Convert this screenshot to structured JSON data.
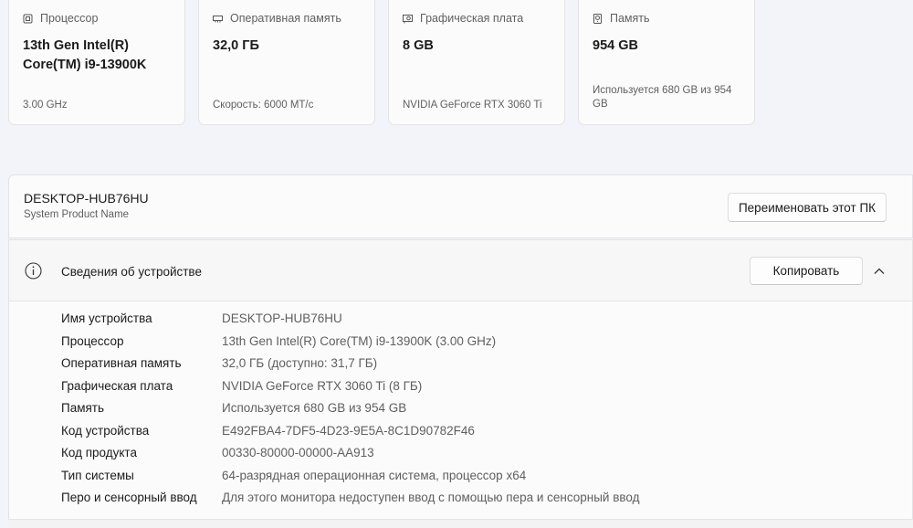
{
  "cards": [
    {
      "icon": "cpu-icon",
      "title": "Процессор",
      "value": "13th Gen Intel(R) Core(TM) i9-13900K",
      "sub": "3.00 GHz"
    },
    {
      "icon": "ram-icon",
      "title": "Оперативная память",
      "value": "32,0 ГБ",
      "sub": "Скорость: 6000 МТ/с"
    },
    {
      "icon": "gpu-icon",
      "title": "Графическая плата",
      "value": "8 GB",
      "sub": "NVIDIA GeForce RTX 3060 Ti"
    },
    {
      "icon": "storage-icon",
      "title": "Память",
      "value": "954 GB",
      "sub": "Используется 680 GB из 954 GB"
    }
  ],
  "pc": {
    "name": "DESKTOP-HUB76HU",
    "model": "System Product Name",
    "rename_label": "Переименовать этот ПК"
  },
  "device_info": {
    "title": "Сведения об устройстве",
    "copy_label": "Копировать",
    "rows": [
      {
        "label": "Имя устройства",
        "value": "DESKTOP-HUB76HU"
      },
      {
        "label": "Процессор",
        "value": "13th Gen Intel(R) Core(TM) i9-13900K (3.00 GHz)"
      },
      {
        "label": "Оперативная память",
        "value": "32,0 ГБ (доступно: 31,7 ГБ)"
      },
      {
        "label": "Графическая плата",
        "value": "NVIDIA GeForce RTX 3060 Ti (8 ГБ)"
      },
      {
        "label": "Память",
        "value": "Используется 680 GB из 954 GB"
      },
      {
        "label": "Код устройства",
        "value": "E492FBA4-7DF5-4D23-9E5A-8C1D90782F46"
      },
      {
        "label": "Код продукта",
        "value": "00330-80000-00000-AA913"
      },
      {
        "label": "Тип системы",
        "value": "64-разрядная операционная система, процессор x64"
      },
      {
        "label": "Перо и сенсорный ввод",
        "value": "Для этого монитора недоступен ввод с помощью пера и сенсорный ввод"
      }
    ]
  }
}
